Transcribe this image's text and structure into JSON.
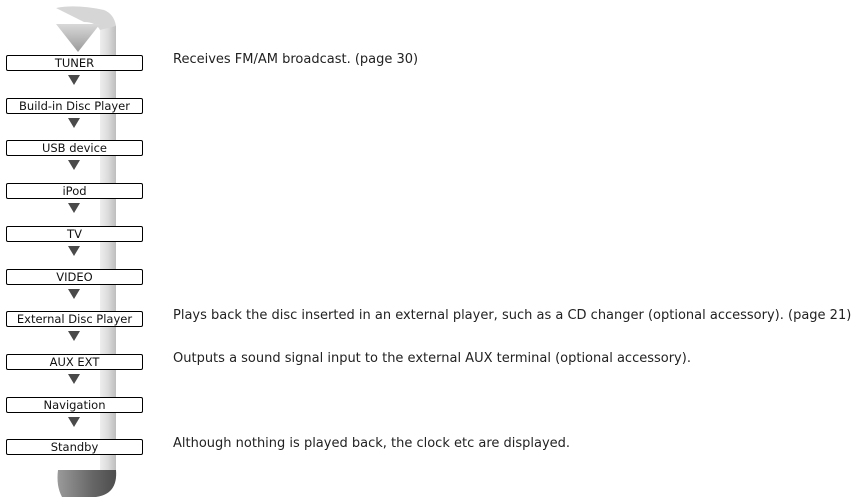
{
  "sources": [
    {
      "label": "TUNER",
      "description": "Receives FM/AM broadcast. (page 30)"
    },
    {
      "label": "Build-in Disc Player",
      "description": ""
    },
    {
      "label": "USB device",
      "description": ""
    },
    {
      "label": "iPod",
      "description": ""
    },
    {
      "label": "TV",
      "description": ""
    },
    {
      "label": "VIDEO",
      "description": ""
    },
    {
      "label": "External Disc Player",
      "description": "Plays back the disc inserted in an external player, such as a CD changer (optional accessory). (page 21)"
    },
    {
      "label": "AUX EXT",
      "description": "Outputs a sound signal input to the external AUX terminal (optional accessory)."
    },
    {
      "label": "Navigation",
      "description": ""
    },
    {
      "label": "Standby",
      "description": "Although nothing is played back, the clock etc are displayed."
    }
  ],
  "colors": {
    "band_light": "#e9e9e9",
    "band_mid": "#c8c8c8",
    "band_dark": "#6e6e6e",
    "arrow": "#4a4a4a",
    "box_border": "#000000",
    "text": "#222222"
  }
}
